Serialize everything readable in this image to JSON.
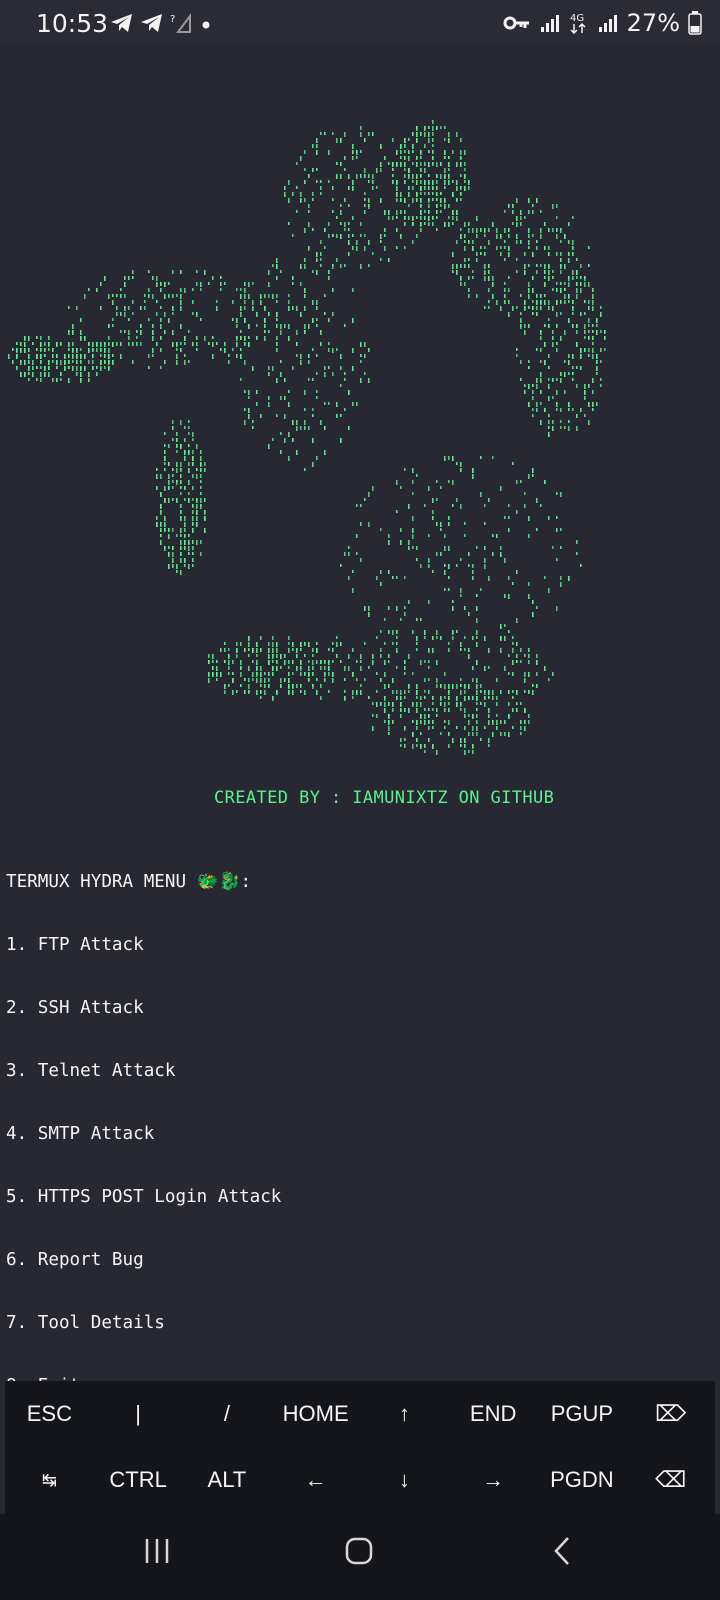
{
  "status_bar": {
    "time": "10:53",
    "battery": "27%",
    "network": "4G",
    "icons": [
      "telegram-icon",
      "telegram-icon",
      "no-signal-icon",
      "dot-icon",
      "vpn-key-icon",
      "signal-icon",
      "signal-icon",
      "battery-icon"
    ]
  },
  "terminal": {
    "credit": "CREATED BY : IAMUNIXTZ ON GITHUB",
    "menu_title": "TERMUX HYDRA MENU 🐲🐉:",
    "menu_items": [
      "1. FTP Attack",
      "2. SSH Attack",
      "3. Telnet Attack",
      "4. SMTP Attack",
      "5. HTTPS POST Login Attack",
      "6. Report Bug",
      "7. Tool Details",
      "8. Exit"
    ],
    "prompt": "============>> : ",
    "colors": {
      "ascii_art": "#5cf08f",
      "text": "#f4f4f4",
      "cursor": "#1aa0c8",
      "background": "#272831"
    }
  },
  "extra_keys": {
    "row1": [
      "ESC",
      "|",
      "/",
      "HOME",
      "↑",
      "END",
      "PGUP",
      "⌦"
    ],
    "row2": [
      "↹",
      "CTRL",
      "ALT",
      "←",
      "↓",
      "→",
      "PGDN",
      "⌫"
    ]
  },
  "nav_bar": {
    "icons": [
      "recents-icon",
      "home-icon",
      "back-icon"
    ]
  }
}
